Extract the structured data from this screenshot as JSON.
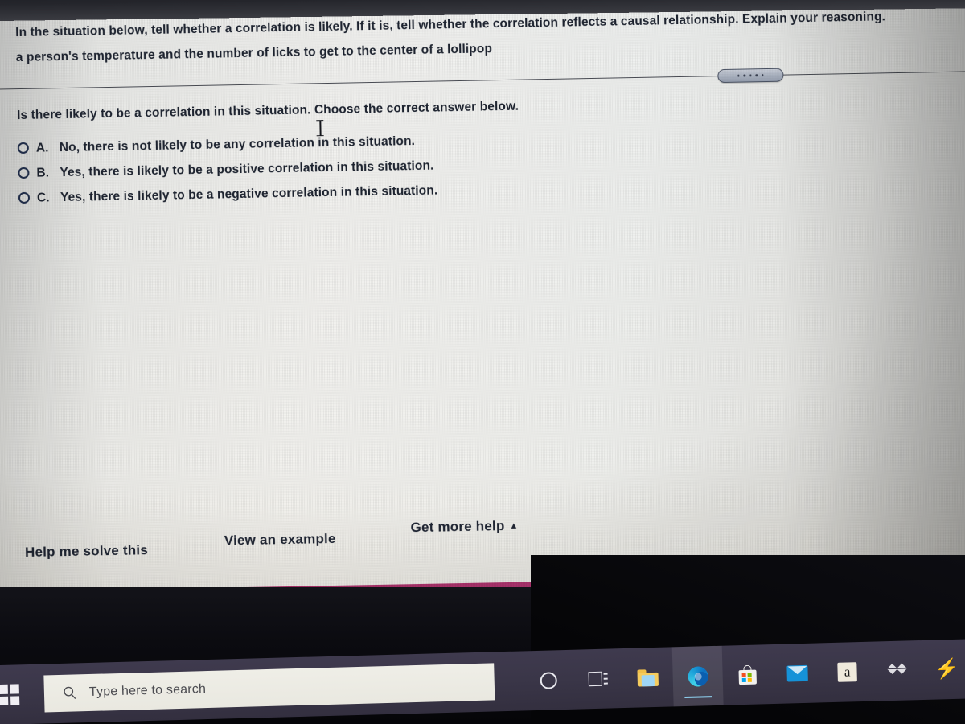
{
  "question": {
    "prompt_line1": "In the situation below, tell whether a correlation is likely. If it is, tell whether the correlation reflects a causal relationship. Explain your reasoning.",
    "prompt_line2": "a person's temperature and the number of licks to get to the center of a lollipop",
    "choose_instruction": "Is there likely to be a correlation in this situation. Choose the correct answer below.",
    "options": [
      {
        "letter": "A.",
        "text": "No, there is not likely to be any correlation in this situation.",
        "selected": false
      },
      {
        "letter": "B.",
        "text": "Yes, there is likely to be a positive correlation in this situation.",
        "selected": false
      },
      {
        "letter": "C.",
        "text": "Yes, there is likely to be a negative correlation in this situation.",
        "selected": false
      }
    ]
  },
  "help_links": {
    "solve": "Help me solve this",
    "example": "View an example",
    "more_help": "Get more help",
    "more_help_caret": "▲"
  },
  "divider": {
    "grip_icon": "horizontal-grip-dots"
  },
  "taskbar": {
    "start_icon": "windows-start-icon",
    "search_placeholder": "Type here to search",
    "search_icon": "search-icon",
    "items": [
      {
        "name": "cortana-icon",
        "label": "Cortana"
      },
      {
        "name": "task-view-icon",
        "label": "Task View"
      },
      {
        "name": "file-explorer-icon",
        "label": "File Explorer"
      },
      {
        "name": "microsoft-edge-icon",
        "label": "Microsoft Edge",
        "active": true
      },
      {
        "name": "microsoft-store-icon",
        "label": "Microsoft Store"
      },
      {
        "name": "mail-icon",
        "label": "Mail"
      },
      {
        "name": "amazon-icon",
        "label": "Amazon"
      },
      {
        "name": "dropbox-icon",
        "label": "Dropbox"
      },
      {
        "name": "lightning-icon",
        "label": "Lightning"
      }
    ]
  },
  "colors": {
    "text": "#1d2330",
    "radio_border": "#22304e",
    "wallpaper_magenta": "#a82f66",
    "wallpaper_orange": "#d2793a",
    "taskbar": "#3a3648",
    "edge_accent": "#8fd3f2"
  },
  "cursor": {
    "type": "text-ibeam"
  }
}
